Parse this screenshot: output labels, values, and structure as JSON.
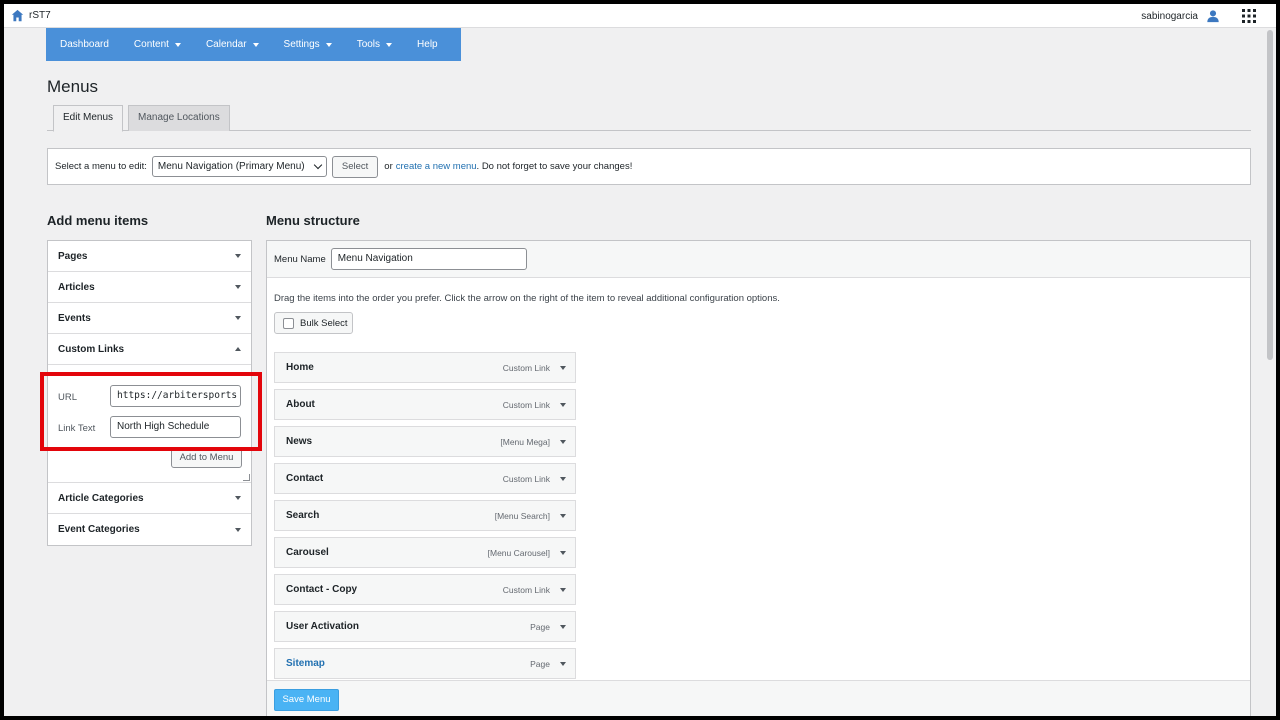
{
  "app": {
    "site_name": "rST7",
    "username": "sabinogarcia"
  },
  "nav": {
    "items": [
      {
        "label": "Dashboard",
        "has_dropdown": false
      },
      {
        "label": "Content",
        "has_dropdown": true
      },
      {
        "label": "Calendar",
        "has_dropdown": true
      },
      {
        "label": "Settings",
        "has_dropdown": true
      },
      {
        "label": "Tools",
        "has_dropdown": true
      },
      {
        "label": "Help",
        "has_dropdown": false
      }
    ],
    "background": "#4a90d9"
  },
  "page": {
    "title": "Menus",
    "tabs": [
      {
        "label": "Edit Menus",
        "active": true
      },
      {
        "label": "Manage Locations",
        "active": false
      }
    ]
  },
  "select_bar": {
    "prompt": "Select a menu to edit:",
    "selected_menu": "Menu Navigation (Primary Menu)",
    "select_button": "Select",
    "or_text": "or",
    "create_link": "create a new menu",
    "save_note": ". Do not forget to save your changes!"
  },
  "add_items": {
    "heading": "Add menu items",
    "sections_top": [
      "Pages",
      "Articles",
      "Events"
    ],
    "custom_links": {
      "label": "Custom Links",
      "url_label": "URL",
      "url_value": "https://arbitersports",
      "link_text_label": "Link Text",
      "link_text_value": "North High Schedule",
      "add_button": "Add to Menu"
    },
    "sections_bottom": [
      "Article Categories",
      "Event Categories"
    ]
  },
  "structure": {
    "heading": "Menu structure",
    "menu_name_label": "Menu Name",
    "menu_name_value": "Menu Navigation",
    "instructions": "Drag the items into the order you prefer. Click the arrow on the right of the item to reveal additional configuration options.",
    "bulk_select": "Bulk Select",
    "items": [
      {
        "title": "Home",
        "type": "Custom Link"
      },
      {
        "title": "About",
        "type": "Custom Link"
      },
      {
        "title": "News",
        "type": "[Menu Mega]"
      },
      {
        "title": "Contact",
        "type": "Custom Link"
      },
      {
        "title": "Search",
        "type": "[Menu Search]"
      },
      {
        "title": "Carousel",
        "type": "[Menu Carousel]"
      },
      {
        "title": "Contact - Copy",
        "type": "Custom Link"
      },
      {
        "title": "User Activation",
        "type": "Page"
      },
      {
        "title": "Sitemap",
        "type": "Page"
      }
    ],
    "save_button": "Save Menu"
  },
  "colors": {
    "accent": "#2271b1",
    "save_button": "#4ab3f4",
    "highlight": "#e3050b"
  }
}
